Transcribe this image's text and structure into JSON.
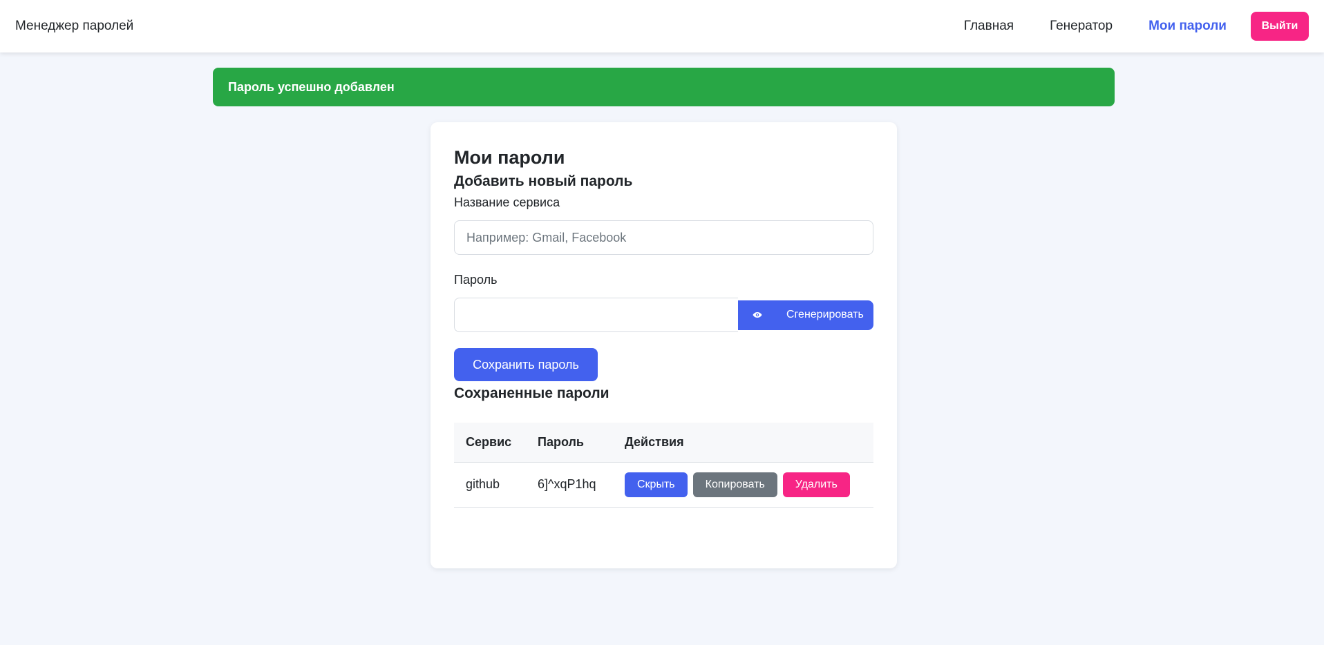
{
  "nav": {
    "brand": "Менеджер паролей",
    "links": [
      "Главная",
      "Генератор",
      "Мои пароли"
    ],
    "active_link": "Мои пароли",
    "logout_label": "Выйти"
  },
  "alert": {
    "message": "Пароль успешно добавлен",
    "color": "#28a745"
  },
  "page": {
    "title": "Мои пароли",
    "add_title": "Добавить новый пароль",
    "service_label": "Название сервиса",
    "service_placeholder": "Например: Gmail, Facebook",
    "service_value": "",
    "password_label": "Пароль",
    "password_value": "",
    "eye_icon": "eye-icon",
    "generate_label": "Сгенерировать",
    "save_label": "Сохранить пароль",
    "saved_title": "Сохраненные пароли"
  },
  "table": {
    "headers": [
      "Сервис",
      "Пароль",
      "Действия"
    ],
    "rows": [
      {
        "service": "github",
        "password": "6]^xqP1hq",
        "actions": [
          "Скрыть",
          "Копировать",
          "Удалить"
        ]
      }
    ]
  },
  "colors": {
    "primary": "#4361ee",
    "danger": "#f72585",
    "secondary": "#6c757d",
    "success": "#28a745",
    "background": "#f3f6fc"
  }
}
